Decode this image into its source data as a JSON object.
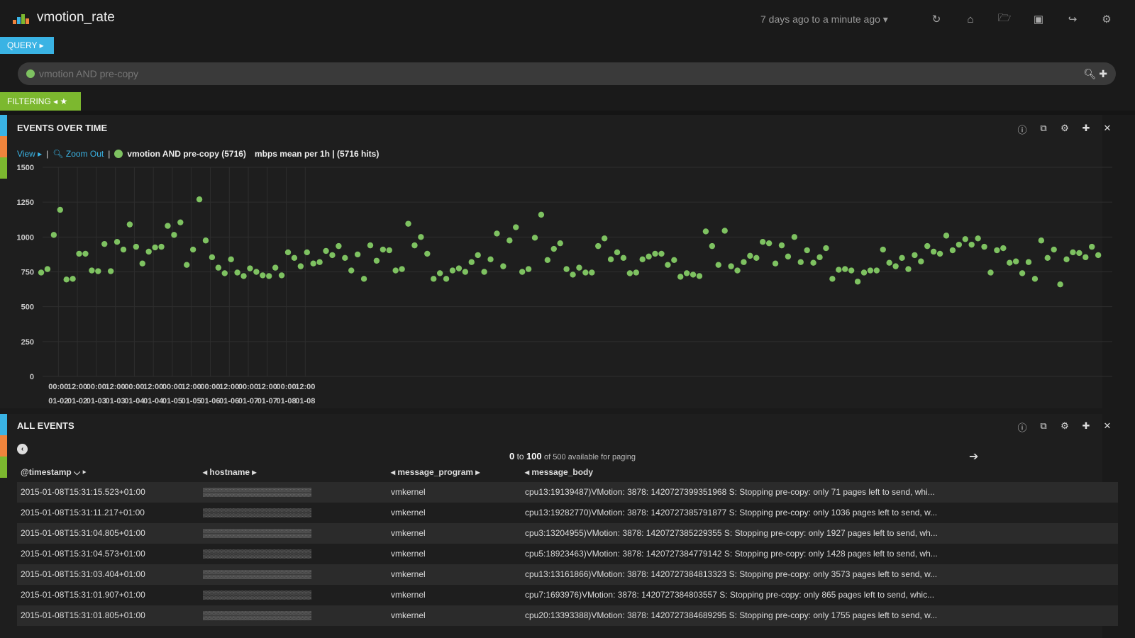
{
  "app": {
    "title": "vmotion_rate",
    "timerange": "7 days ago to a minute ago ▾",
    "nav_icons": [
      "refresh-icon",
      "home-icon",
      "folder-icon",
      "save-icon",
      "share-icon",
      "gear-icon"
    ]
  },
  "query": {
    "tab_label": "QUERY ▸",
    "value": "vmotion AND pre-copy",
    "dot_color": "#7ec261"
  },
  "filtering": {
    "tab_label": "FILTERING ◂ ★"
  },
  "events_panel": {
    "title": "EVENTS OVER TIME",
    "legend": {
      "view": "View ▸",
      "sep1": "|",
      "zoom_out": "Zoom Out",
      "sep2": "|",
      "series": "vmotion AND pre-copy (5716)",
      "metric": "mbps mean per 1h | (5716 hits)"
    }
  },
  "chart_data": {
    "type": "scatter",
    "series": [
      {
        "name": "vmotion AND pre-copy (5716)",
        "color": "#7ec261"
      }
    ],
    "ylim": [
      0,
      1500
    ],
    "yticks": [
      "0",
      "250",
      "500",
      "750",
      "1000",
      "1250",
      "1500"
    ],
    "x_start": "01-01 14:00",
    "x_step_hours": 4,
    "xticks": [
      [
        "00:00",
        "01-02"
      ],
      [
        "12:00",
        "01-02"
      ],
      [
        "00:00",
        "01-03"
      ],
      [
        "12:00",
        "01-03"
      ],
      [
        "00:00",
        "01-04"
      ],
      [
        "12:00",
        "01-04"
      ],
      [
        "00:00",
        "01-05"
      ],
      [
        "12:00",
        "01-05"
      ],
      [
        "00:00",
        "01-06"
      ],
      [
        "12:00",
        "01-06"
      ],
      [
        "00:00",
        "01-07"
      ],
      [
        "12:00",
        "01-07"
      ],
      [
        "00:00",
        "01-08"
      ],
      [
        "12:00",
        "01-08"
      ]
    ],
    "values": [
      745,
      770,
      1015,
      1195,
      695,
      700,
      880,
      880,
      760,
      755,
      950,
      755,
      965,
      910,
      1090,
      930,
      810,
      895,
      925,
      930,
      1080,
      1015,
      1105,
      800,
      910,
      1270,
      975,
      855,
      780,
      740,
      840,
      745,
      720,
      775,
      750,
      725,
      720,
      780,
      725,
      890,
      850,
      790,
      890,
      810,
      820,
      900,
      870,
      935,
      850,
      760,
      875,
      700,
      940,
      830,
      910,
      905,
      760,
      770,
      1095,
      940,
      1000,
      880,
      700,
      740,
      700,
      760,
      775,
      750,
      820,
      870,
      750,
      840,
      1025,
      790,
      975,
      1070,
      750,
      770,
      995,
      1160,
      835,
      915,
      955,
      770,
      730,
      780,
      745,
      745,
      935,
      990,
      840,
      890,
      850,
      740,
      745,
      840,
      860,
      880,
      880,
      800,
      835,
      715,
      740,
      730,
      720,
      1040,
      935,
      800,
      1045,
      790,
      760,
      820,
      865,
      850,
      965,
      955,
      810,
      940,
      860,
      1000,
      820,
      905,
      815,
      855,
      920,
      700,
      765,
      770,
      760,
      680,
      745,
      760,
      760,
      910,
      815,
      790,
      850,
      770,
      870,
      825,
      935,
      895,
      880,
      1010,
      905,
      945,
      985,
      945,
      990,
      930,
      745,
      905,
      920,
      815,
      825,
      740,
      820,
      700,
      975,
      850,
      910,
      660,
      840,
      890,
      885,
      855,
      930,
      870
    ]
  },
  "all_events": {
    "title": "ALL EVENTS",
    "pager": {
      "from": "0",
      "to_word": "to",
      "to": "100",
      "rest": "of 500 available for paging"
    },
    "columns": [
      {
        "label": "@timestamp ⌵ ▸"
      },
      {
        "label": "◂ hostname ▸"
      },
      {
        "label": "◂ message_program ▸"
      },
      {
        "label": "◂ message_body"
      }
    ],
    "rows": [
      {
        "ts": "2015-01-08T15:31:15.523+01:00",
        "host": "▒▒▒▒▒▒▒▒▒▒▒▒▒▒▒▒▒▒",
        "prog": "vmkernel",
        "body": "cpu13:19139487)VMotion: 3878: 1420727399351968 S: Stopping pre-copy: only 71 pages left to send, whi..."
      },
      {
        "ts": "2015-01-08T15:31:11.217+01:00",
        "host": "▒▒▒▒▒▒▒▒▒▒▒▒▒▒▒▒▒▒",
        "prog": "vmkernel",
        "body": "cpu13:19282770)VMotion: 3878: 1420727385791877 S: Stopping pre-copy: only 1036 pages left to send, w..."
      },
      {
        "ts": "2015-01-08T15:31:04.805+01:00",
        "host": "▒▒▒▒▒▒▒▒▒▒▒▒▒▒▒▒▒▒",
        "prog": "vmkernel",
        "body": "cpu3:13204955)VMotion: 3878: 1420727385229355 S: Stopping pre-copy: only 1927 pages left to send, wh..."
      },
      {
        "ts": "2015-01-08T15:31:04.573+01:00",
        "host": "▒▒▒▒▒▒▒▒▒▒▒▒▒▒▒▒▒▒",
        "prog": "vmkernel",
        "body": "cpu5:18923463)VMotion: 3878: 1420727384779142 S: Stopping pre-copy: only 1428 pages left to send, wh..."
      },
      {
        "ts": "2015-01-08T15:31:03.404+01:00",
        "host": "▒▒▒▒▒▒▒▒▒▒▒▒▒▒▒▒▒▒",
        "prog": "vmkernel",
        "body": "cpu13:13161866)VMotion: 3878: 1420727384813323 S: Stopping pre-copy: only 3573 pages left to send, w..."
      },
      {
        "ts": "2015-01-08T15:31:01.907+01:00",
        "host": "▒▒▒▒▒▒▒▒▒▒▒▒▒▒▒▒▒▒",
        "prog": "vmkernel",
        "body": "cpu7:1693976)VMotion: 3878: 1420727384803557 S: Stopping pre-copy: only 865 pages left to send, whic..."
      },
      {
        "ts": "2015-01-08T15:31:01.805+01:00",
        "host": "▒▒▒▒▒▒▒▒▒▒▒▒▒▒▒▒▒▒",
        "prog": "vmkernel",
        "body": "cpu20:13393388)VMotion: 3878: 1420727384689295 S: Stopping pre-copy: only 1755 pages left to send, w..."
      }
    ]
  },
  "colors": {
    "accent_blue": "#3ab3e4",
    "accent_green": "#7cb82f",
    "accent_orange": "#ef843c",
    "point": "#7ec261"
  }
}
